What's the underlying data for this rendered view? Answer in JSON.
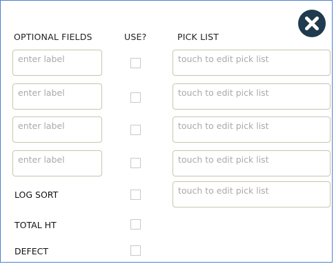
{
  "headers": {
    "optional_fields": "OPTIONAL FIELDS",
    "use": "USE?",
    "pick_list": "PICK LIST"
  },
  "label_placeholder": "enter label",
  "pick_placeholder": "touch to edit pick list",
  "fixed_fields": [
    "LOG SORT",
    "TOTAL HT",
    "DEFECT"
  ],
  "checkboxes_checked": [
    false,
    false,
    false,
    false,
    false,
    false,
    false
  ],
  "colors": {
    "close_button": "#1f3b4d",
    "frame_border": "#4a7fcf",
    "input_border": "#c9c3ad",
    "placeholder_text": "#a9a9a9"
  },
  "icons": {
    "close": "close-circle-icon"
  }
}
